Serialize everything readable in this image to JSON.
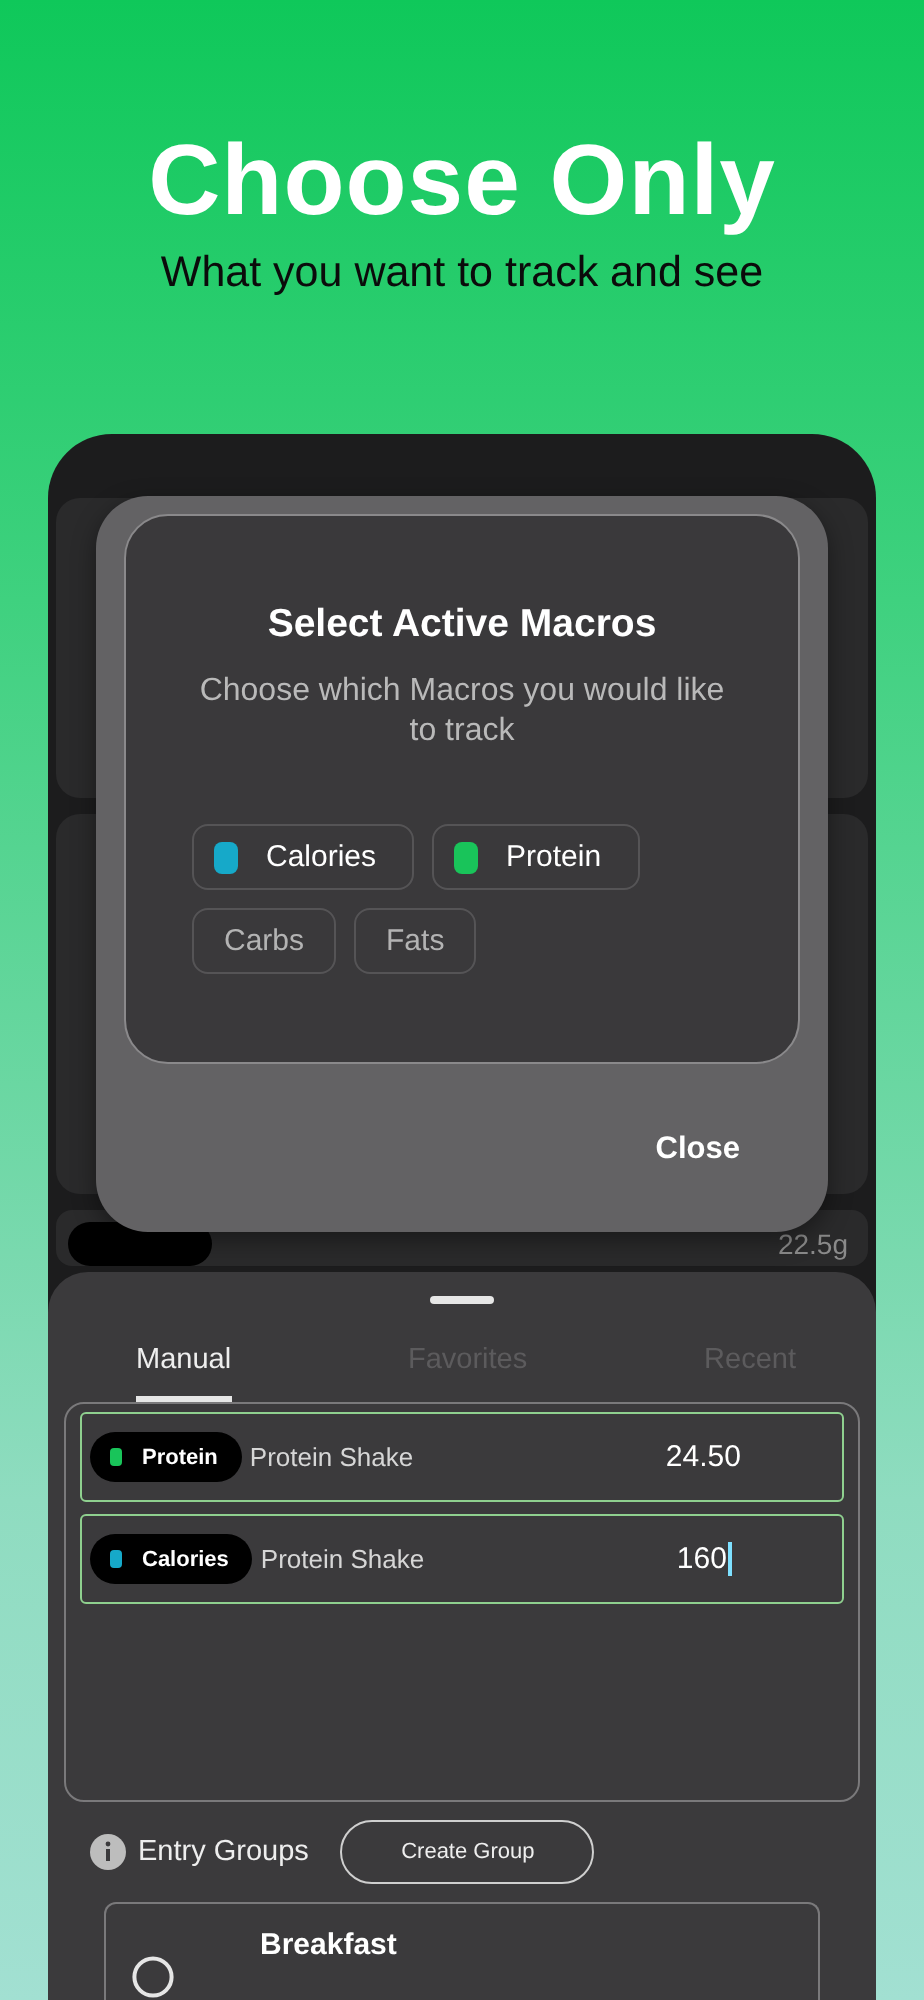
{
  "headline": "Choose Only",
  "subheadline": "What you want to track and see",
  "background_row": {
    "amount": "22.5g"
  },
  "dialog": {
    "title": "Select Active Macros",
    "description": "Choose which Macros you would like to track",
    "macros": [
      {
        "label": "Calories",
        "selected": true,
        "color": "#16a9c9"
      },
      {
        "label": "Protein",
        "selected": true,
        "color": "#19c45a"
      },
      {
        "label": "Carbs",
        "selected": false
      },
      {
        "label": "Fats",
        "selected": false
      }
    ],
    "close": "Close"
  },
  "sheet": {
    "tabs": [
      {
        "label": "Manual",
        "selected": true
      },
      {
        "label": "Favorites",
        "selected": false
      },
      {
        "label": "Recent",
        "selected": false
      }
    ],
    "entries": [
      {
        "macro": "Protein",
        "color": "#19c45a",
        "food": "Protein Shake",
        "value": "24.50",
        "focused": false
      },
      {
        "macro": "Calories",
        "color": "#16a9c9",
        "food": "Protein Shake",
        "value": "160",
        "focused": true
      }
    ],
    "entry_groups_label": "Entry Groups",
    "create_group": "Create Group",
    "groups": [
      {
        "name": "Breakfast",
        "selected": false
      }
    ]
  }
}
